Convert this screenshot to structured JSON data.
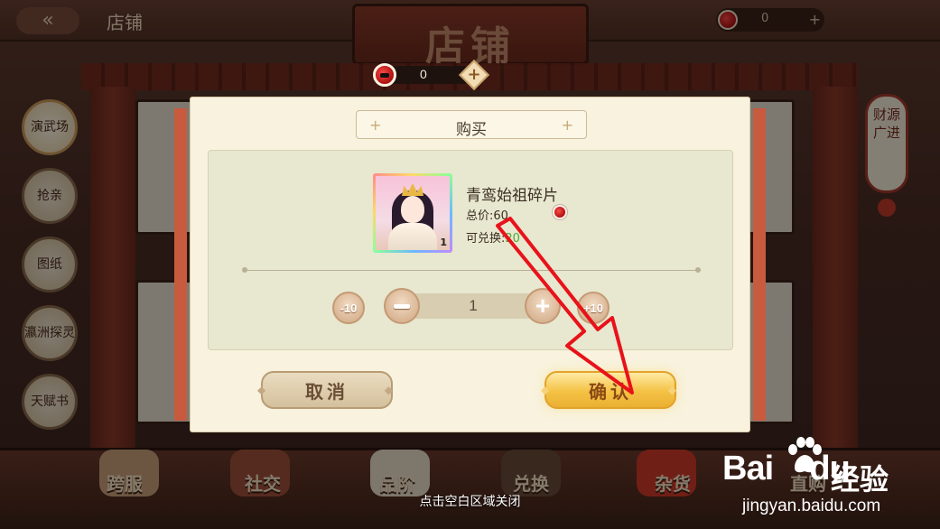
{
  "background": {
    "header_title": "店铺",
    "back_glyph": "«",
    "banner_title": "店铺",
    "top_currency_value": "0",
    "side_menu": [
      "演武场",
      "抢亲",
      "图纸",
      "瀛洲探灵",
      "天赋书"
    ],
    "right_banner": "财源广进",
    "bottom_tabs": [
      "跨服",
      "社交",
      "品阶",
      "兑换",
      "杂货",
      "直购"
    ]
  },
  "currency_pill": {
    "value": "0",
    "icon": "red-black-coin-icon",
    "plus_glyph": "+"
  },
  "dialog": {
    "title": "购买",
    "title_deco": "+",
    "item": {
      "name": "青鸾始祖碎片",
      "price_label": "总价:60",
      "exchangeable_label": "可兑换:",
      "exchangeable_value": "20",
      "stack_count": "1",
      "icon": "character-portrait-icon"
    },
    "quantity": {
      "minus10": "-10",
      "value": "1",
      "plus10": "+10",
      "plus1_glyph": "+"
    },
    "cancel_label": "取消",
    "confirm_label": "确认"
  },
  "hint": "点击空白区域关闭",
  "watermark": {
    "logo_bai": "Bai",
    "logo_du": "du",
    "label_cn": "经验",
    "url": "jingyan.baidu.com"
  },
  "colors": {
    "confirm": "#f4c244",
    "arrow": "#e8121a",
    "exchange_count": "#4caa3a"
  }
}
